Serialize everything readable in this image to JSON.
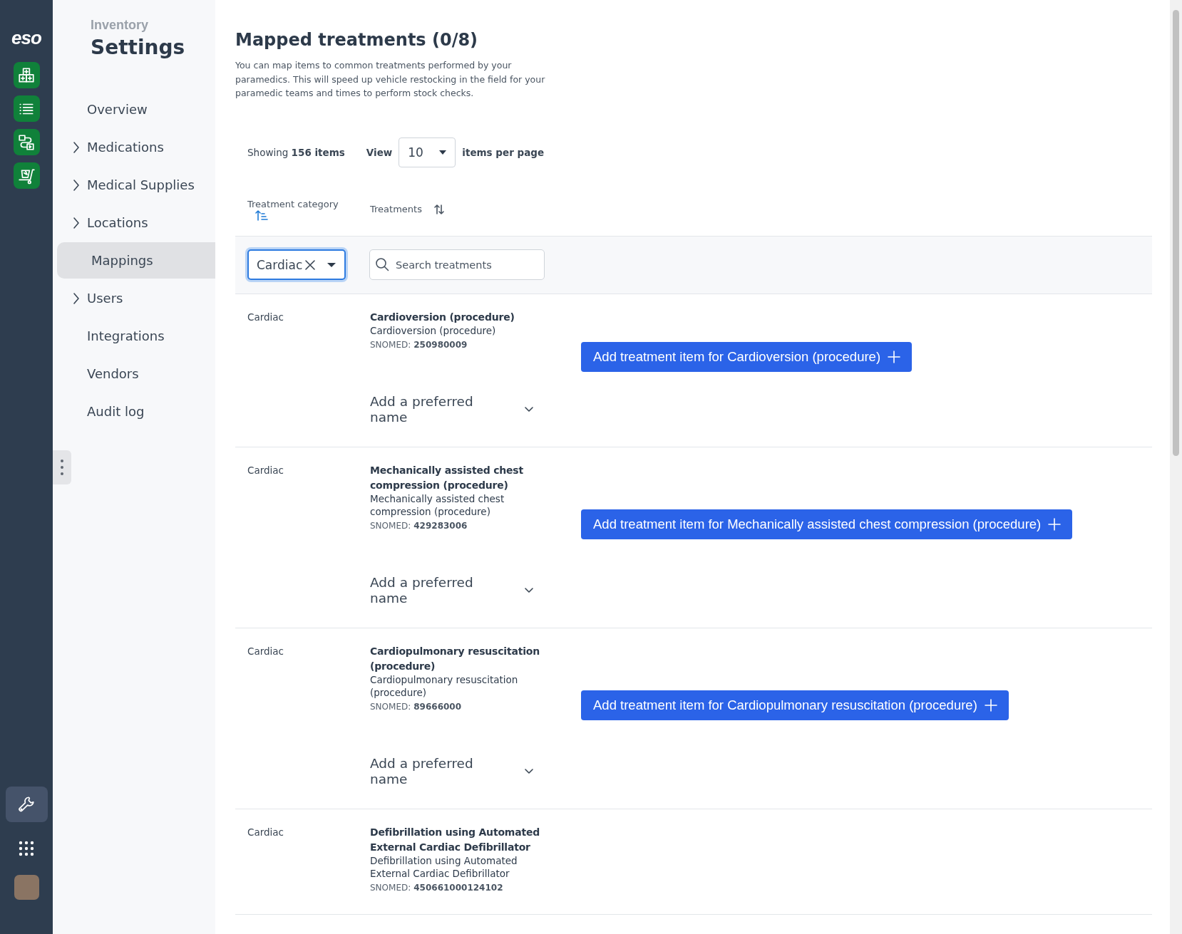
{
  "rail": {
    "logo": "eso",
    "items": [
      {
        "kind": "boxes",
        "selected": false
      },
      {
        "kind": "list",
        "selected": false
      },
      {
        "kind": "flow",
        "selected": false
      },
      {
        "kind": "cart",
        "selected": false
      }
    ],
    "bottom": [
      {
        "kind": "wrench",
        "selected": true
      },
      {
        "kind": "apps",
        "selected": false
      },
      {
        "kind": "avatar"
      }
    ]
  },
  "sidebar": {
    "section": "Inventory",
    "title": "Settings",
    "items": [
      {
        "label": "Overview",
        "expandable": false,
        "selected": false
      },
      {
        "label": "Medications",
        "expandable": true,
        "selected": false
      },
      {
        "label": "Medical Supplies",
        "expandable": true,
        "selected": false
      },
      {
        "label": "Locations",
        "expandable": true,
        "selected": false
      },
      {
        "label": "Mappings",
        "expandable": false,
        "selected": true
      },
      {
        "label": "Users",
        "expandable": true,
        "selected": false
      },
      {
        "label": "Integrations",
        "expandable": false,
        "selected": false
      },
      {
        "label": "Vendors",
        "expandable": false,
        "selected": false
      },
      {
        "label": "Audit log",
        "expandable": false,
        "selected": false
      }
    ]
  },
  "main": {
    "title": "Mapped treatments (0/8)",
    "description": "You can map items to common treatments performed by your paramedics. This will speed up vehicle restocking in the field for your paramedic teams and times to perform stock checks.",
    "paging": {
      "showing": "Showing **156 items**",
      "view_label": "View",
      "per_page": "10",
      "suffix": "items per page"
    },
    "columns": [
      {
        "label": "Treatment category",
        "sorted": true
      },
      {
        "label": "Treatments",
        "sorted": false
      }
    ],
    "filters": {
      "category": {
        "value": "Cardiac",
        "focused": true
      },
      "search": {
        "placeholder": "Search treatments"
      }
    },
    "rows": [
      {
        "category": "Cardiac",
        "name": "Cardioversion (procedure)",
        "description": "Cardioversion (procedure)",
        "snomed_label": "SNOMED:",
        "snomed": "250980009",
        "button": "Add treatment item for Cardioversion (procedure)",
        "preferred_name": "Add a preferred name"
      },
      {
        "category": "Cardiac",
        "name": "Mechanically assisted chest compression (procedure)",
        "description": "Mechanically assisted chest compression (procedure)",
        "snomed_label": "SNOMED:",
        "snomed": "429283006",
        "button": "Add treatment item for Mechanically assisted chest compression (procedure)",
        "preferred_name": "Add a preferred name"
      },
      {
        "category": "Cardiac",
        "name": "Cardiopulmonary resuscitation (procedure)",
        "description": "Cardiopulmonary resuscitation (procedure)",
        "snomed_label": "SNOMED:",
        "snomed": "89666000",
        "button": "Add treatment item for Cardiopulmonary resuscitation (procedure)",
        "preferred_name": "Add a preferred name"
      },
      {
        "category": "Cardiac",
        "name": "Defibrillation using Automated External Cardiac Defibrillator",
        "description": "Defibrillation using Automated External Cardiac Defibrillator",
        "snomed_label": "SNOMED:",
        "snomed": "450661000124102"
      }
    ]
  }
}
